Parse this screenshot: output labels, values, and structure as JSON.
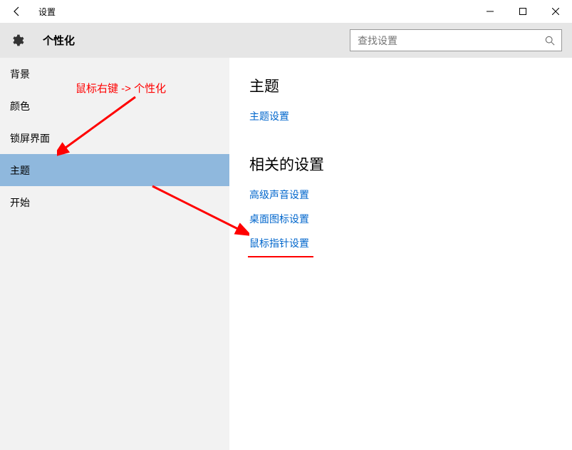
{
  "window": {
    "title": "设置"
  },
  "header": {
    "page_title": "个性化",
    "search_placeholder": "查找设置"
  },
  "sidebar": {
    "items": [
      {
        "label": "背景"
      },
      {
        "label": "颜色"
      },
      {
        "label": "锁屏界面"
      },
      {
        "label": "主题"
      },
      {
        "label": "开始"
      }
    ]
  },
  "content": {
    "section1_title": "主题",
    "section1_links": [
      {
        "label": "主题设置"
      }
    ],
    "section2_title": "相关的设置",
    "section2_links": [
      {
        "label": "高级声音设置"
      },
      {
        "label": "桌面图标设置"
      },
      {
        "label": "鼠标指针设置"
      }
    ]
  },
  "annotation": {
    "text": "鼠标右键 -> 个性化"
  }
}
